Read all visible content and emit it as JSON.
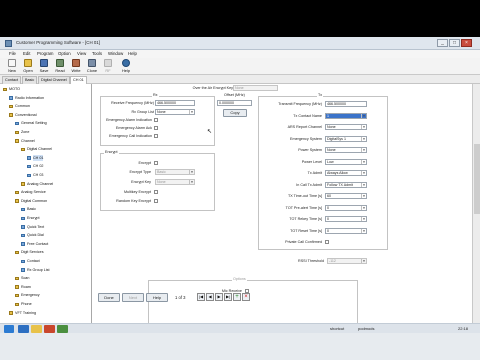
{
  "window": {
    "title": "Customer Programming Software - [CH 01]",
    "buttons": [
      "_",
      "□",
      "×"
    ]
  },
  "menu": [
    "File",
    "Edit",
    "Program",
    "Option",
    "View",
    "Tools",
    "Window",
    "Help"
  ],
  "toolbar": [
    {
      "label": "New",
      "enabled": true,
      "icon": "new-file-icon"
    },
    {
      "label": "Open",
      "enabled": true,
      "icon": "open-folder-icon"
    },
    {
      "label": "Save",
      "enabled": true,
      "icon": "save-disk-icon"
    },
    {
      "label": "Read",
      "enabled": true,
      "icon": "read-radio-icon"
    },
    {
      "label": "Write",
      "enabled": true,
      "icon": "write-radio-icon"
    },
    {
      "label": "Clone",
      "enabled": true,
      "icon": "clone-icon"
    },
    {
      "label": "RF",
      "enabled": false,
      "icon": "rf-icon"
    },
    {
      "label": "Help",
      "enabled": true,
      "icon": "help-icon"
    }
  ],
  "tabs": [
    "Contact",
    "Basic",
    "Digital Channel",
    "CH 01"
  ],
  "tree": [
    {
      "label": "MOTO",
      "indent": 0,
      "icon": "folder"
    },
    {
      "label": "Radio Information",
      "indent": 1,
      "icon": "doc"
    },
    {
      "label": "Common",
      "indent": 1,
      "icon": "folder"
    },
    {
      "label": "Conventional",
      "indent": 1,
      "icon": "folder"
    },
    {
      "label": "General Setting",
      "indent": 2,
      "icon": "doc"
    },
    {
      "label": "Zone",
      "indent": 2,
      "icon": "folder"
    },
    {
      "label": "Channel",
      "indent": 2,
      "icon": "folder"
    },
    {
      "label": "Digital Channel",
      "indent": 3,
      "icon": "folder"
    },
    {
      "label": "CH 01",
      "indent": 4,
      "icon": "doc"
    },
    {
      "label": "CH 02",
      "indent": 4,
      "icon": "doc"
    },
    {
      "label": "CH 03",
      "indent": 4,
      "icon": "doc"
    },
    {
      "label": "Analog Channel",
      "indent": 3,
      "icon": "folder"
    },
    {
      "label": "Analog Service",
      "indent": 2,
      "icon": "folder"
    },
    {
      "label": "Digital Common",
      "indent": 2,
      "icon": "folder"
    },
    {
      "label": "Basic",
      "indent": 3,
      "icon": "doc"
    },
    {
      "label": "Encrypt",
      "indent": 3,
      "icon": "doc"
    },
    {
      "label": "Quick Text",
      "indent": 3,
      "icon": "doc"
    },
    {
      "label": "Quick Dial",
      "indent": 3,
      "icon": "doc"
    },
    {
      "label": "Free Contact",
      "indent": 3,
      "icon": "doc"
    },
    {
      "label": "Digit Services",
      "indent": 2,
      "icon": "folder"
    },
    {
      "label": "Contact",
      "indent": 3,
      "icon": "doc"
    },
    {
      "label": "Rx Group List",
      "indent": 3,
      "icon": "doc"
    },
    {
      "label": "Scan",
      "indent": 2,
      "icon": "folder"
    },
    {
      "label": "Roam",
      "indent": 2,
      "icon": "folder"
    },
    {
      "label": "Emergency",
      "indent": 2,
      "icon": "folder"
    },
    {
      "label": "Phone",
      "indent": 2,
      "icon": "folder"
    },
    {
      "label": "VFT Training",
      "indent": 1,
      "icon": "folder"
    }
  ],
  "top_field": {
    "label": "Over the Air Encrypt Key",
    "value": "None"
  },
  "rx": {
    "title": "Rx",
    "freq_label": "Receive Frequency (MHz)",
    "freq_value": "466.500000",
    "group_label": "Rx Group List",
    "group_value": "None",
    "checks": [
      {
        "label": "Emergency Alarm Indication",
        "checked": false
      },
      {
        "label": "Emergency Alarm Ack",
        "checked": false
      },
      {
        "label": "Emergency Call Indication",
        "checked": false
      }
    ]
  },
  "offset": {
    "title": "Offset (MHz)",
    "value": "0.000000",
    "button": "Copy"
  },
  "encrypt": {
    "title": "Encrypt",
    "encrypt_label": "Encrypt",
    "type_label": "Encrypt Type",
    "type_value": "Basic",
    "key_label": "Encrypt Key",
    "key_value": "None",
    "multikey_label": "Multikey Encrypt",
    "random_label": "Random Key Encrypt"
  },
  "tx": {
    "title": "Tx",
    "fields": [
      {
        "label": "Transmit Frequency (MHz)",
        "value": "466.500000",
        "kind": "text"
      },
      {
        "label": "Tx Contact Name",
        "value": "1",
        "kind": "combo",
        "selected": true
      },
      {
        "label": "ARS Report Channel",
        "value": "None",
        "kind": "combo"
      },
      {
        "label": "Emergency System",
        "value": "DigitalSys 1",
        "kind": "combo"
      },
      {
        "label": "Power System",
        "value": "None",
        "kind": "combo"
      },
      {
        "label": "Power Level",
        "value": "Low",
        "kind": "combo"
      },
      {
        "label": "Tx Admit",
        "value": "Always Allow",
        "kind": "combo"
      },
      {
        "label": "In Call Tx Admit",
        "value": "Follow TX Admit",
        "kind": "combo"
      },
      {
        "label": "TX Time-out Time [s]",
        "value": "60",
        "kind": "combo"
      },
      {
        "label": "TOT Pre-alert Time [s]",
        "value": "0",
        "kind": "combo"
      },
      {
        "label": "TOT Rekey Time [s]",
        "value": "0",
        "kind": "combo"
      },
      {
        "label": "TOT Reset Time [s]",
        "value": "0",
        "kind": "combo"
      },
      {
        "label": "Private Call Confirmed",
        "value": "",
        "kind": "check"
      }
    ]
  },
  "rssi": {
    "label": "RSSI Threshold",
    "value": "-112"
  },
  "bottom": {
    "group_title": "Options",
    "mic_label": "Mic Receive",
    "buttons": [
      {
        "label": "Done",
        "enabled": true
      },
      {
        "label": "Next",
        "enabled": false
      },
      {
        "label": "Help",
        "enabled": true
      }
    ],
    "page": "1 of 3",
    "nav_icons": [
      "first-icon",
      "prev-icon",
      "next-icon",
      "last-icon",
      "add-icon",
      "delete-icon"
    ]
  },
  "taskbar": {
    "items": [
      "shortcut",
      "podmods"
    ],
    "time": "22:18"
  },
  "colors": {
    "accent": "#3a6ea5",
    "tree_selected": "#cfe0f5",
    "selected_field": "#3b73c9",
    "delete": "#d02020"
  }
}
